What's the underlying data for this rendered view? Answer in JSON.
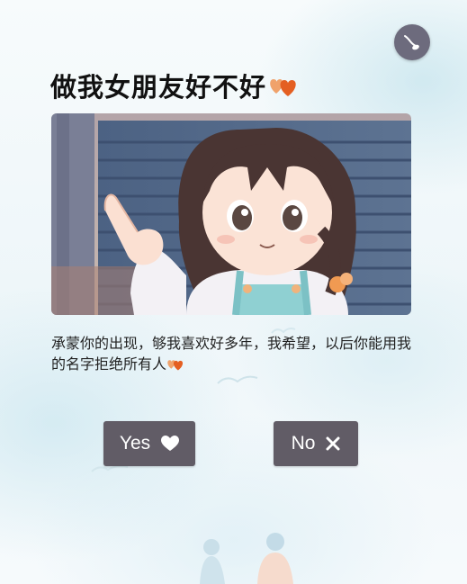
{
  "title": "做我女朋友好不好",
  "message": "承蒙你的出现，够我喜欢好多年，我希望，以后你能用我的名字拒绝所有人",
  "buttons": {
    "yes_label": "Yes",
    "no_label": "No"
  },
  "icons": {
    "music": "music-note-icon",
    "title_hearts": "hearts-icon",
    "yes": "heart-icon",
    "no": "close-icon"
  },
  "colors": {
    "button_bg": "#615c66",
    "music_button_bg": "#6d6b7d",
    "heart_accent": "#e8662c",
    "title_text": "#111111"
  }
}
